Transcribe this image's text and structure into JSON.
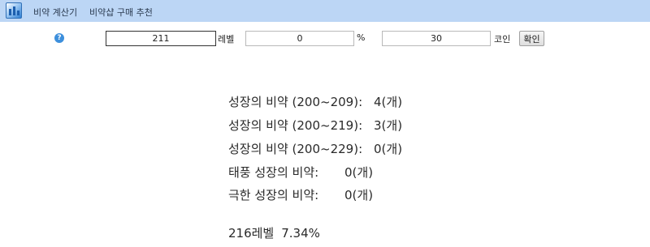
{
  "nav": {
    "logo_icon": "app-logo-icon",
    "links": [
      "비약 계산기",
      "비약샵 구매 추천"
    ]
  },
  "form": {
    "help_icon": "?",
    "level_value": "211",
    "level_unit": "레벨",
    "percent_value": "0",
    "percent_unit": "%",
    "coin_value": "30",
    "coin_unit": "코인",
    "confirm_label": "확인"
  },
  "results": [
    {
      "label": "성장의 비약 (200~209):",
      "value": "4(개)"
    },
    {
      "label": "성장의 비약 (200~219):",
      "value": "3(개)"
    },
    {
      "label": "성장의 비약 (200~229):",
      "value": "0(개)"
    },
    {
      "label": "태풍 성장의 비약:",
      "value": "0(개)"
    },
    {
      "label": "극한 성장의 비약:",
      "value": "0(개)"
    }
  ],
  "summary": {
    "level": "216레벨",
    "percent": "7.34%"
  },
  "colors": {
    "navbar": "#bcd6f5",
    "help_icon": "#3d8fdc"
  }
}
